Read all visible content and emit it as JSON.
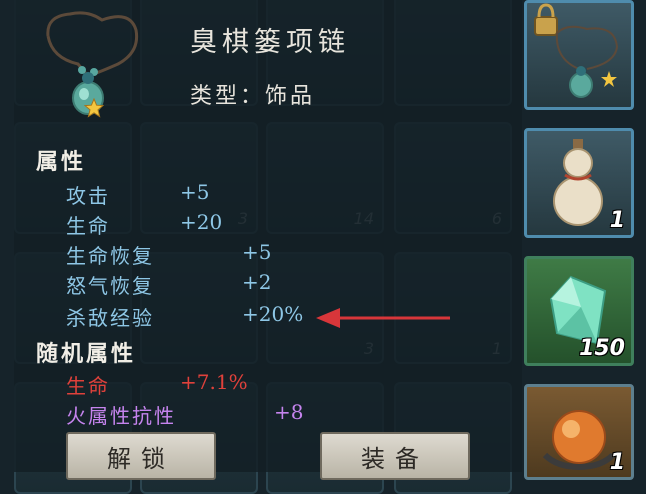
{
  "item": {
    "name": "臭棋篓项链",
    "type_label": "类型：",
    "type_value": "饰品"
  },
  "attributes": {
    "heading": "属性",
    "stats": [
      {
        "name": "攻击",
        "value": "+5"
      },
      {
        "name": "生命",
        "value": "+20"
      },
      {
        "name": "生命恢复",
        "value": "+5"
      },
      {
        "name": "怒气恢复",
        "value": "+2"
      },
      {
        "name": "杀敌经验",
        "value": "+20%"
      }
    ]
  },
  "random_attributes": {
    "heading": "随机属性",
    "stats": [
      {
        "name": "生命",
        "value": "+7.1%"
      },
      {
        "name": "火属性抗性",
        "value": "+8"
      }
    ]
  },
  "buttons": {
    "unlock": "解锁",
    "equip": "装备"
  },
  "background_counts": [
    "3",
    "14",
    "6",
    "3",
    "1"
  ],
  "side_slots": [
    {
      "icon": "necklace-locked-icon",
      "count": ""
    },
    {
      "icon": "gourd-icon",
      "count": "1"
    },
    {
      "icon": "green-crystal-icon",
      "count": "150"
    },
    {
      "icon": "amber-gem-icon",
      "count": "1"
    }
  ],
  "colors": {
    "attribute_text": "#8ec7e6",
    "random_life": "#e0413b",
    "random_fire": "#c584ee",
    "arrow": "#d8363a"
  }
}
